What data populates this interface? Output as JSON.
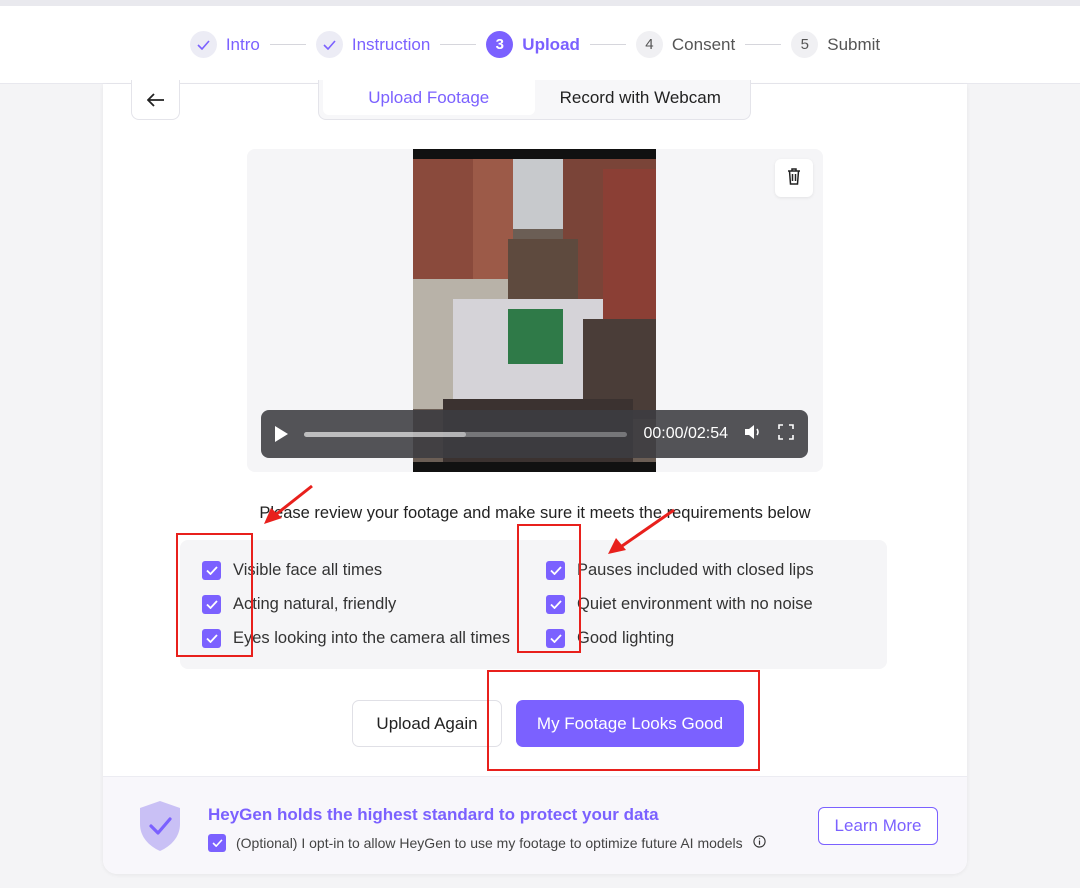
{
  "stepper": {
    "steps": [
      {
        "label": "Intro",
        "state": "done",
        "marker": "check"
      },
      {
        "label": "Instruction",
        "state": "done",
        "marker": "check"
      },
      {
        "label": "Upload",
        "state": "active",
        "marker": "3"
      },
      {
        "label": "Consent",
        "state": "todo",
        "marker": "4"
      },
      {
        "label": "Submit",
        "state": "todo",
        "marker": "5"
      }
    ]
  },
  "header": {
    "back_icon": "arrow-left-icon",
    "tabs": [
      {
        "label": "Upload Footage",
        "active": true
      },
      {
        "label": "Record with Webcam",
        "active": false
      }
    ]
  },
  "video": {
    "time": "00:00/02:54",
    "progress_buffered": 0.5,
    "progress_played": 0.0,
    "icons": [
      "play-icon",
      "volume-icon",
      "fullscreen-icon",
      "trash-icon"
    ]
  },
  "review": {
    "instruction": "Please review your footage and make sure it meets the requirements below",
    "requirements_left": [
      {
        "label": "Visible face all times",
        "checked": true
      },
      {
        "label": "Acting natural, friendly",
        "checked": true
      },
      {
        "label": "Eyes looking into the camera all times",
        "checked": true
      }
    ],
    "requirements_right": [
      {
        "label": "Pauses included with closed lips",
        "checked": true
      },
      {
        "label": "Quiet environment with no noise",
        "checked": true
      },
      {
        "label": "Good lighting",
        "checked": true
      }
    ]
  },
  "actions": {
    "upload_again": "Upload Again",
    "looks_good": "My Footage Looks Good"
  },
  "footer": {
    "title": "HeyGen holds the highest standard to protect your data",
    "opt_in": "(Optional) I opt-in to allow HeyGen to use my footage to optimize future AI models",
    "opt_in_checked": true,
    "learn_more": "Learn More"
  },
  "colors": {
    "accent": "#7b61ff",
    "annotation": "#e8201c"
  }
}
